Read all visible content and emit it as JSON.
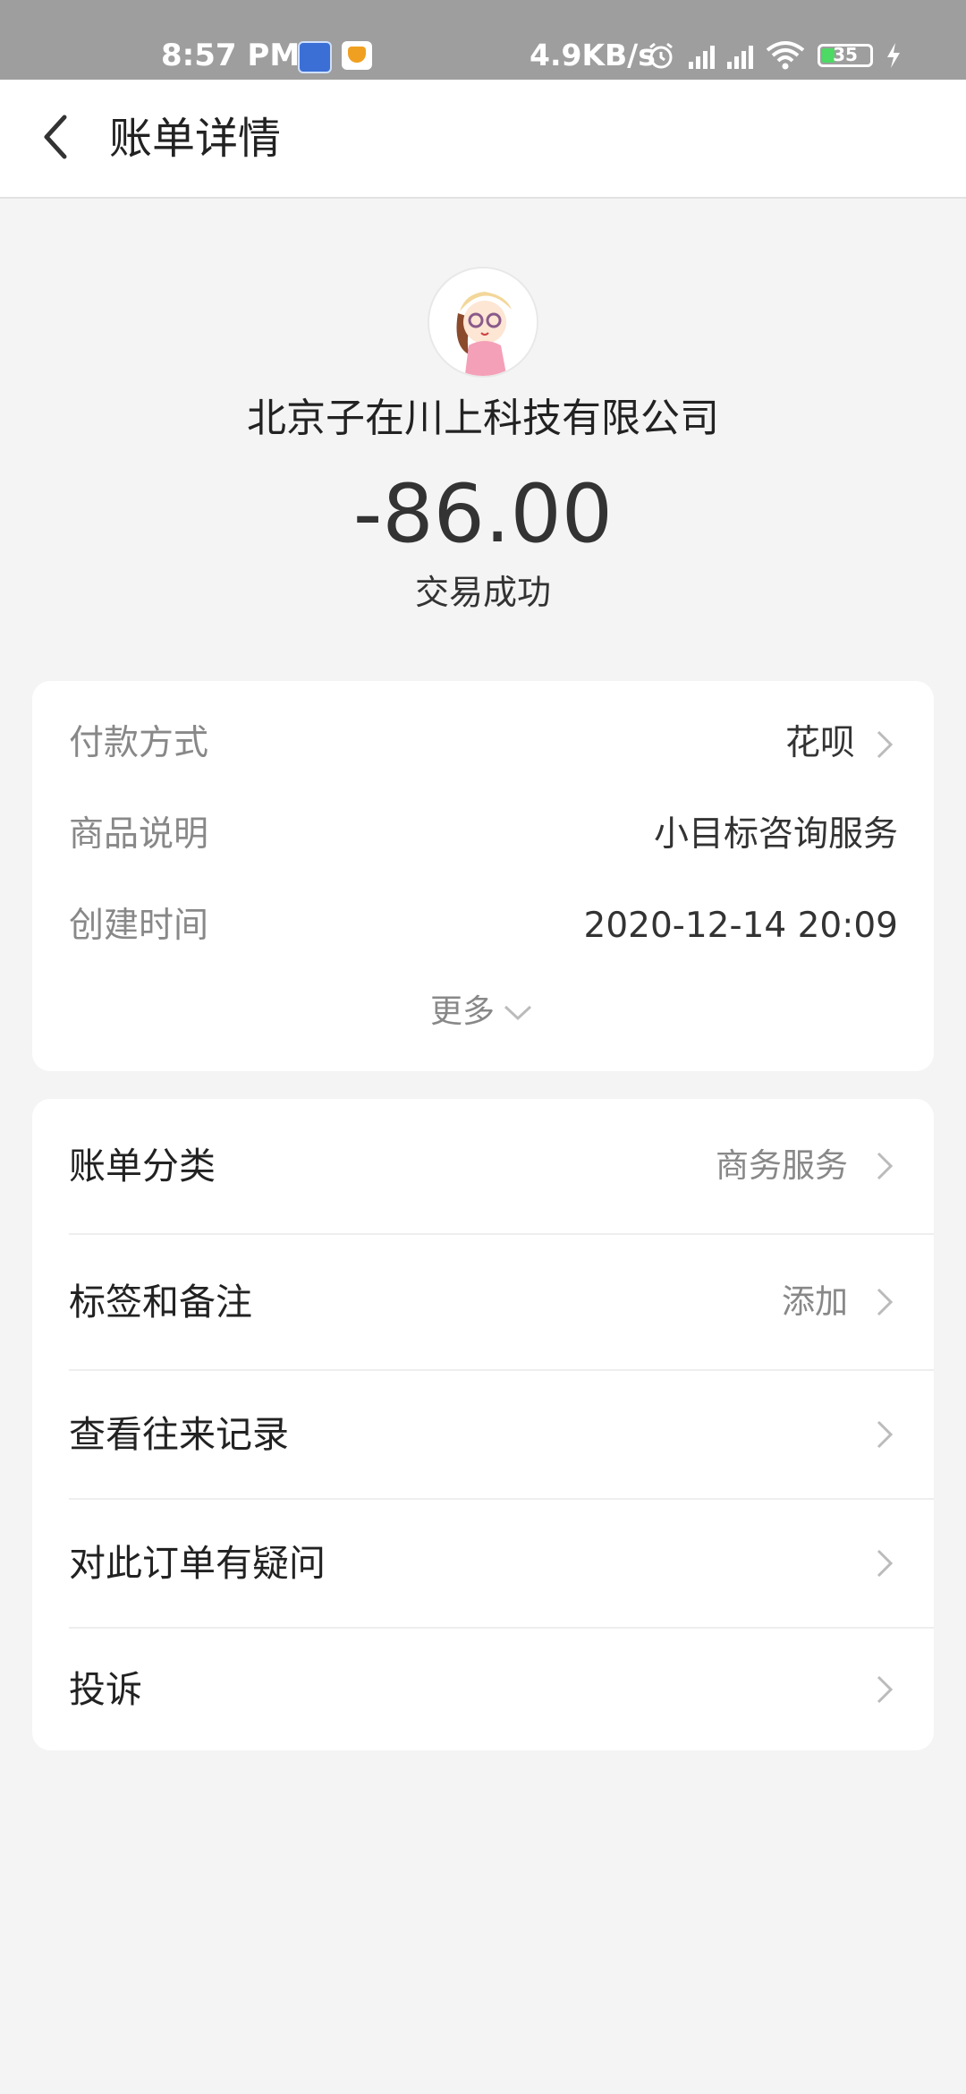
{
  "status_bar": {
    "time": "8:57 PM",
    "network_speed": "4.9KB/s",
    "battery": "35"
  },
  "header": {
    "title": "账单详情",
    "back_icon": "back-chevron-icon"
  },
  "transaction": {
    "merchant": "北京子在川上科技有限公司",
    "amount": "-86.00",
    "status": "交易成功"
  },
  "details": {
    "rows": [
      {
        "label": "付款方式",
        "value": "花呗"
      },
      {
        "label": "商品说明",
        "value": "小目标咨询服务"
      },
      {
        "label": "创建时间",
        "value": "2020-12-14 20:09"
      }
    ],
    "more_label": "更多"
  },
  "actions": {
    "items": [
      {
        "label": "账单分类",
        "value": "商务服务"
      },
      {
        "label": "标签和备注",
        "value": "添加"
      },
      {
        "label": "查看往来记录",
        "value": ""
      },
      {
        "label": "对此订单有疑问",
        "value": ""
      },
      {
        "label": "投诉",
        "value": ""
      }
    ]
  },
  "colors": {
    "background": "#f4f4f4",
    "status_bar": "#9e9e9e",
    "text_primary": "#222222",
    "text_secondary": "#888888",
    "chevron": "#bbbbbb"
  }
}
